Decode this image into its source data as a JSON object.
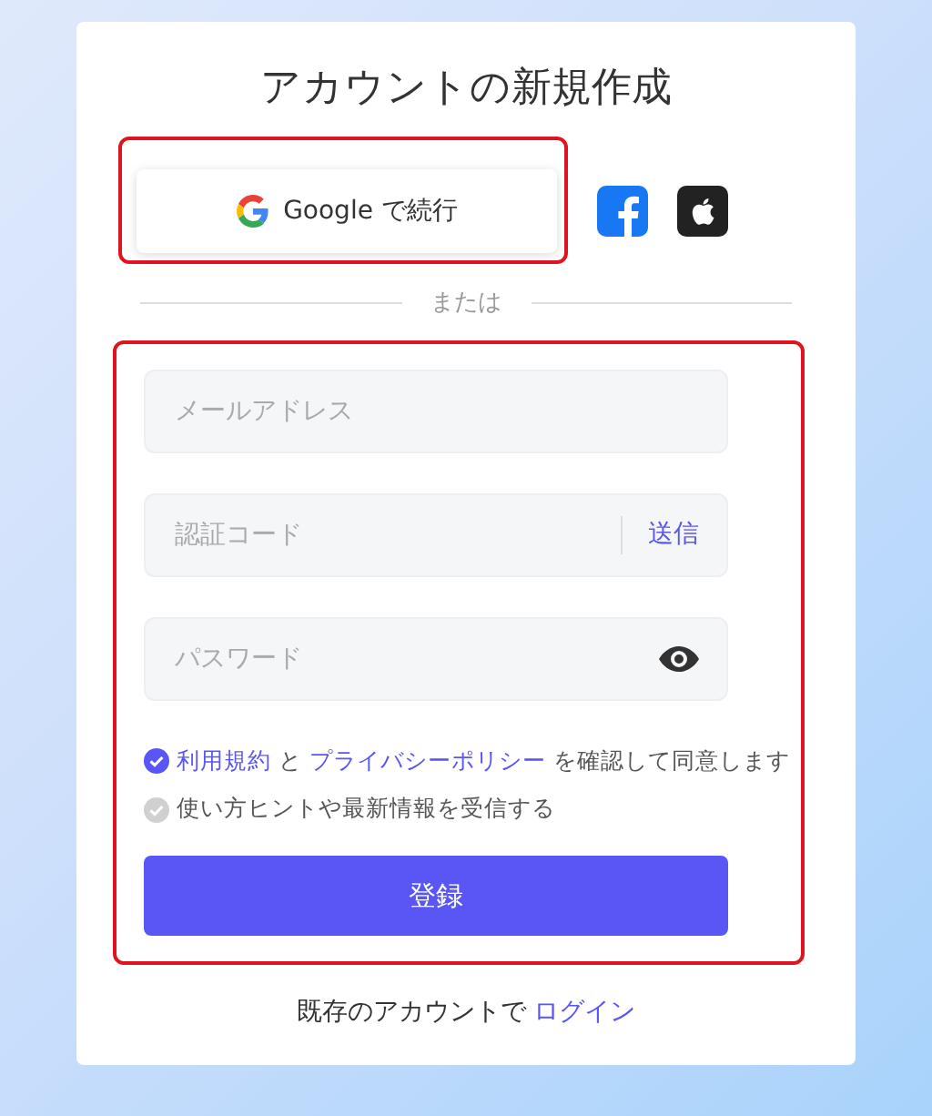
{
  "title": "アカウントの新規作成",
  "social": {
    "google_label": "Google で続行"
  },
  "divider": "または",
  "fields": [
    {
      "kind": "text",
      "placeholder": "メールアドレス"
    },
    {
      "kind": "code",
      "placeholder": "認証コード",
      "action": "送信"
    },
    {
      "kind": "password",
      "placeholder": "パスワード"
    }
  ],
  "options": [
    {
      "checked": true,
      "parts": [
        {
          "text": "利用規約",
          "link": true
        },
        {
          "text": " と ",
          "link": false
        },
        {
          "text": "プライバシーポリシー",
          "link": true
        },
        {
          "text": " を確認して同意します",
          "link": false
        }
      ]
    },
    {
      "checked": false,
      "parts": [
        {
          "text": "使い方ヒントや最新情報を受信する",
          "link": false
        }
      ]
    }
  ],
  "submit": "登録",
  "footer": {
    "text": "既存のアカウントで",
    "link": "ログイン"
  }
}
